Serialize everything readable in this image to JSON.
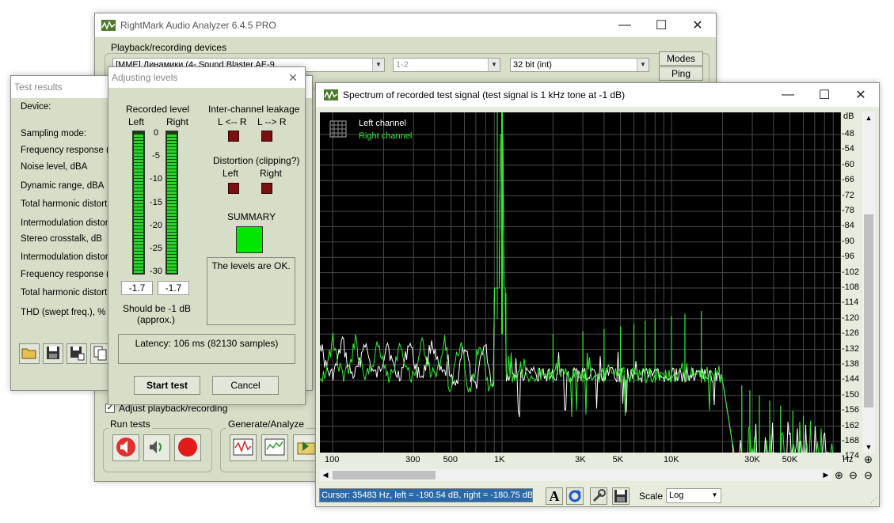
{
  "main": {
    "title": "RightMark Audio Analyzer 6.4.5 PRO",
    "devices_label": "Playback/recording devices",
    "device_value": "[MME] Динамики (4- Sound Blaster AE-9",
    "channels_value": "1-2",
    "bits_value": "32 bit (int)",
    "modes_label": "Modes",
    "ping_label": "Ping",
    "adjust_label": "Adjust playback/recording",
    "run_tests_label": "Run tests",
    "gen_label": "Generate/Analyze",
    "adjust_checked": true
  },
  "results": {
    "title": "Test results",
    "rows": [
      "Device:",
      "Sampling mode:",
      "Frequency response (m",
      "Noise level, dBA",
      "Dynamic range, dBA",
      "Total harmonic distortio",
      "Intermodulation distortio",
      "Stereo crosstalk, dB",
      "Intermodulation distortio",
      "Frequency response (sv",
      "Total harmonic distortio",
      "THD (swept freq.), %"
    ]
  },
  "adjust": {
    "title": "Adjusting levels",
    "recorded_level": "Recorded level",
    "left": "Left",
    "right": "Right",
    "scale": [
      "0",
      "-5",
      "-10",
      "-15",
      "-20",
      "-25",
      "-30"
    ],
    "left_value": "-1.7",
    "right_value": "-1.7",
    "left_level_fraction": 0.97,
    "right_level_fraction": 0.97,
    "should_be": "Should be   -1 dB",
    "approx": "(approx.)",
    "leakage_label": "Inter-channel leakage",
    "l_from_r": "L <-- R",
    "l_to_r": "L --> R",
    "distortion_label": "Distortion (clipping?)",
    "dist_left": "Left",
    "dist_right": "Right",
    "summary_label": "SUMMARY",
    "summary_color": "#00e600",
    "indicator_color": "#7a1010",
    "message": "The levels are OK.",
    "latency": "Latency: 106 ms (82130 samples)",
    "start_label": "Start test",
    "cancel_label": "Cancel"
  },
  "spectrum": {
    "title": "Spectrum of recorded test signal (test signal is 1 kHz tone at -1 dB)",
    "legend_left": "Left channel",
    "legend_right": "Right channel",
    "left_color": "#ffffff",
    "right_color": "#33ee33",
    "y_unit": "dB",
    "y_ticks": [
      "-48",
      "-54",
      "-60",
      "-66",
      "-72",
      "-78",
      "-84",
      "-90",
      "-96",
      "-102",
      "-108",
      "-114",
      "-120",
      "-126",
      "-132",
      "-138",
      "-144",
      "-150",
      "-156",
      "-162",
      "-168",
      "-174"
    ],
    "x_ticks": [
      "100",
      "300",
      "500",
      "1K",
      "3K",
      "5K",
      "10K",
      "30K",
      "50K"
    ],
    "x_unit": "Hz",
    "cursor": "Cursor:  35483 Hz,  left = -190.54 dB,  right = -180.75 dB",
    "scale_label": "Scale",
    "scale_value": "Log"
  }
}
